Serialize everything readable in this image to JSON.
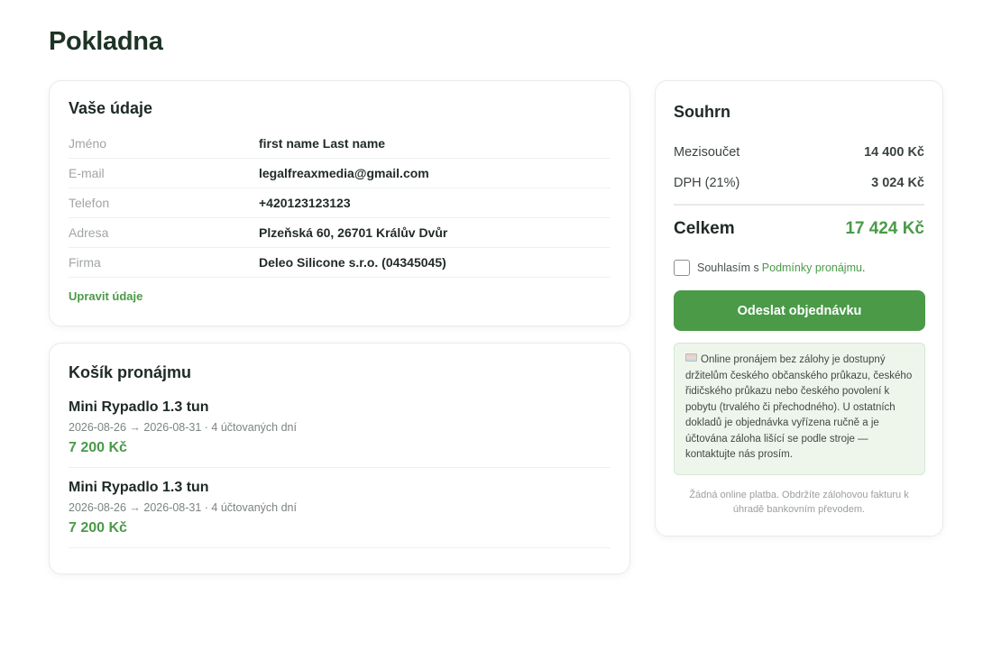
{
  "page": {
    "title": "Pokladna"
  },
  "details": {
    "title": "Vaše údaje",
    "rows": [
      {
        "label": "Jméno",
        "value": "first name Last name"
      },
      {
        "label": "E-mail",
        "value": "legalfreaxmedia@gmail.com"
      },
      {
        "label": "Telefon",
        "value": "+420123123123"
      },
      {
        "label": "Adresa",
        "value": "Plzeňská 60, 26701 Králův Dvůr"
      },
      {
        "label": "Firma",
        "value": "Deleo Silicone s.r.o. (04345045)"
      }
    ],
    "edit_label": "Upravit údaje"
  },
  "cart": {
    "title": "Košík pronájmu",
    "items": [
      {
        "name": "Mini Rypadlo 1.3 tun",
        "meta": "2026-08-26 → 2026-08-31 · 4 účtovaných dní",
        "price": "7 200 Kč"
      },
      {
        "name": "Mini Rypadlo 1.3 tun",
        "meta": "2026-08-26 → 2026-08-31 · 4 účtovaných dní",
        "price": "7 200 Kč"
      }
    ]
  },
  "summary": {
    "title": "Souhrn",
    "subtotal_label": "Mezisoučet",
    "subtotal_value": "14 400 Kč",
    "vat_label": "DPH (21%)",
    "vat_value": "3 024 Kč",
    "total_label": "Celkem",
    "total_value": "17 424 Kč",
    "terms_prefix": "Souhlasím s",
    "terms_link": "Podmínky pronájmu",
    "terms_suffix": ".",
    "terms_checked": false,
    "submit_label": "Odeslat objednávku",
    "notice_icon": "id-card-icon",
    "notice_text": "Online pronájem bez zálohy je dostupný držitelům českého občanského průkazu, českého řidičského průkazu nebo českého povolení k pobytu (trvalého či přechodného). U ostatních dokladů je objednávka vyřízena ručně a je účtována záloha lišící se podle stroje — kontaktujte nás prosím.",
    "footnote": "Žádná online platba. Obdržíte zálohovou fakturu k úhradě bankovním převodem."
  },
  "colors": {
    "accent": "#4a9a48",
    "title": "#1e3325",
    "notice_bg": "#eef6ec"
  }
}
